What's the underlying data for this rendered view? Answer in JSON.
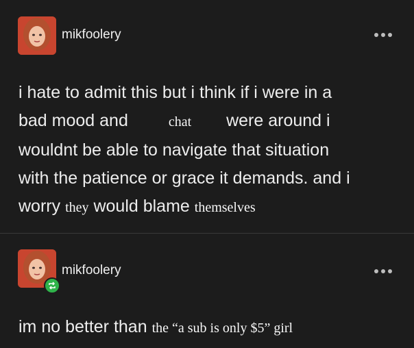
{
  "posts": [
    {
      "username": "mikfoolery",
      "text": {
        "line1": "i hate to admit this but i think if i were in a",
        "line2_a": "bad mood and",
        "line2_overlay": "chat",
        "line2_b": "were around i",
        "line3": "wouldnt be able to navigate that situation",
        "line4": "with the patience or grace it demands. and i",
        "line5_a": "worry",
        "line5_overlay1": "they",
        "line5_b": "would blame",
        "line5_overlay2": "themselves"
      },
      "reblog": false
    },
    {
      "username": "mikfoolery",
      "text": {
        "line1_a": "im no better than",
        "line1_overlay": "the “a sub is only $5” girl"
      },
      "reblog": true
    }
  ],
  "colors": {
    "background": "#1c1c1c",
    "text": "#ededed",
    "reblog_badge": "#2fb34a"
  }
}
